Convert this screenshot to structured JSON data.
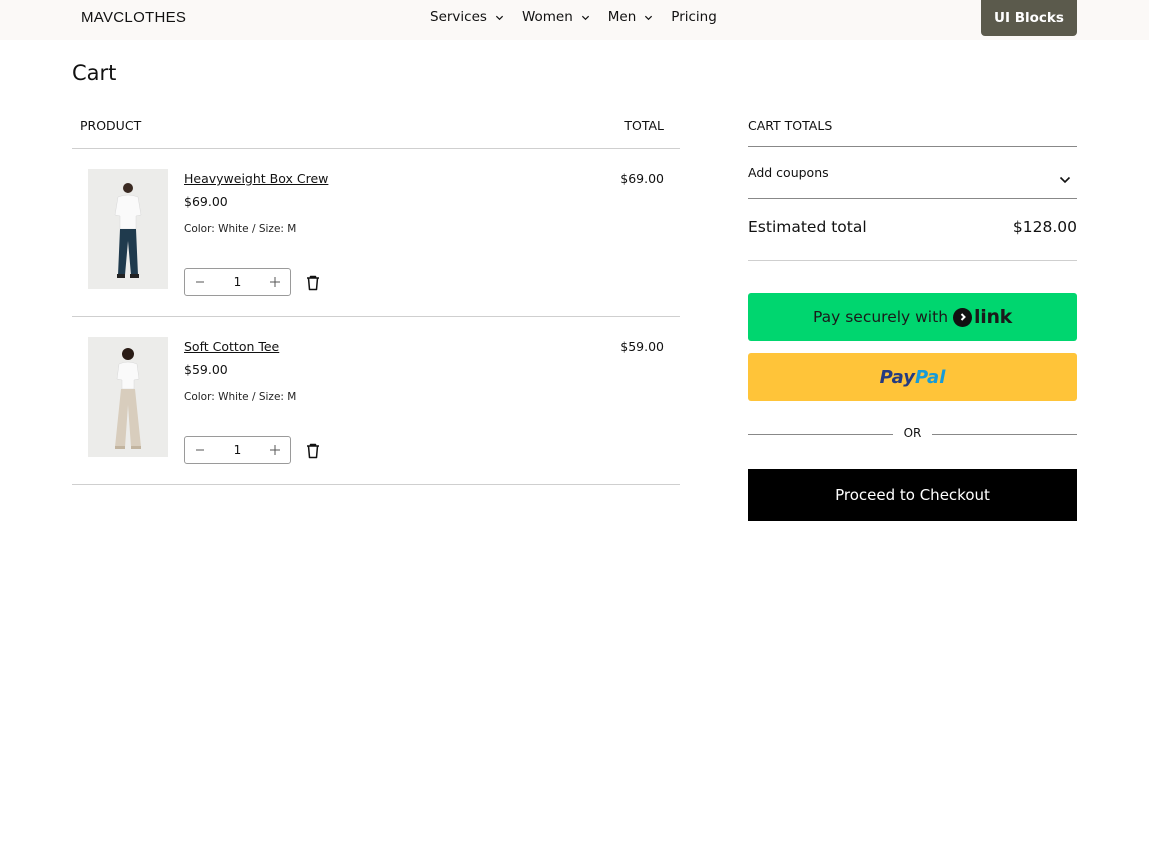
{
  "header": {
    "brand": "MAVCLOTHES",
    "nav": [
      {
        "label": "Services",
        "has_dropdown": true
      },
      {
        "label": "Women",
        "has_dropdown": true
      },
      {
        "label": "Men",
        "has_dropdown": true
      },
      {
        "label": "Pricing",
        "has_dropdown": false
      }
    ],
    "cta_label": "UI Blocks"
  },
  "page": {
    "title": "Cart"
  },
  "cart": {
    "col_product": "PRODUCT",
    "col_total": "TOTAL",
    "items": [
      {
        "name": "Heavyweight Box Crew",
        "price": "$69.00",
        "variant": "Color: White / Size: M",
        "quantity": "1",
        "line_total": "$69.00"
      },
      {
        "name": "Soft Cotton Tee",
        "price": "$59.00",
        "variant": "Color: White / Size: M",
        "quantity": "1",
        "line_total": "$59.00"
      }
    ]
  },
  "totals": {
    "heading": "CART TOTALS",
    "coupons_label": "Add coupons",
    "estimated_label": "Estimated total",
    "estimated_amount": "$128.00",
    "link_prefix": "Pay securely with",
    "link_brand": "link",
    "paypal_part1": "Pay",
    "paypal_part2": "Pal",
    "or_label": "OR",
    "checkout_label": "Proceed to Checkout"
  },
  "colors": {
    "header_bg": "#fbf9f7",
    "cta_bg": "#5b5a4c",
    "link_green": "#00d66f",
    "paypal_yellow": "#ffc439",
    "checkout_bg": "#000000"
  }
}
